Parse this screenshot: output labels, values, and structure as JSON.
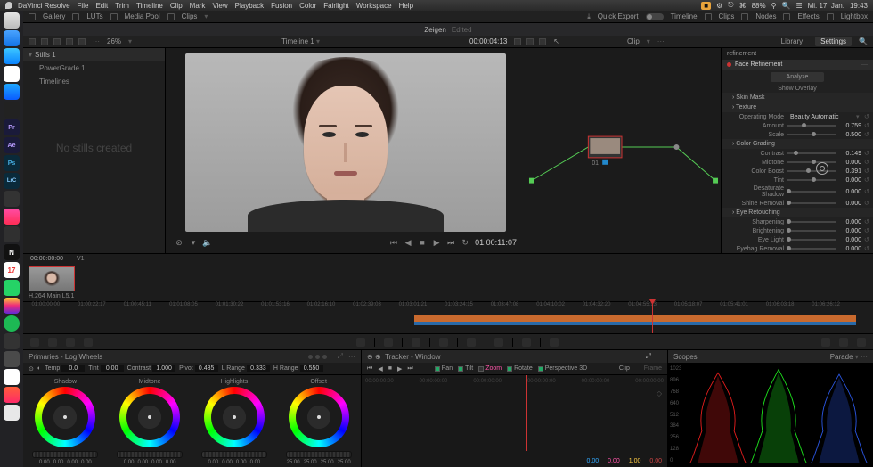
{
  "mac_menu": {
    "app": "DaVinci Resolve",
    "items": [
      "File",
      "Edit",
      "Trim",
      "Timeline",
      "Clip",
      "Mark",
      "View",
      "Playback",
      "Fusion",
      "Color",
      "Fairlight",
      "Workspace",
      "Help"
    ],
    "right": [
      "88%",
      "Mi. 17. Jan.",
      "19:43"
    ]
  },
  "topbar": {
    "items": [
      "Gallery",
      "LUTs",
      "Media Pool",
      "Clips"
    ],
    "right": [
      "Quick Export",
      "Timeline",
      "Clips",
      "Nodes",
      "Effects",
      "Lightbox"
    ]
  },
  "titlebar": {
    "name": "Zeigen",
    "status": "Edited"
  },
  "toolbar2": {
    "zoom": "26%",
    "timeline": "Timeline 1",
    "tc": "00:00:04:13",
    "clip": "Clip",
    "tabs": [
      "Library",
      "Settings"
    ],
    "active": "Settings"
  },
  "stills": {
    "hdr": "Stills 1",
    "rows": [
      "PowerGrade 1",
      "Timelines"
    ],
    "empty": "No stills created"
  },
  "viewer": {
    "tc": "01:00:11:07"
  },
  "nodes": {
    "id": "01"
  },
  "settings": {
    "search": "refinement",
    "section": "Face Refinement",
    "analyze": "Analyze",
    "overlay": "Show Overlay",
    "groups": [
      {
        "name": "Skin Mask"
      },
      {
        "name": "Texture",
        "params": [
          {
            "label": "Operating Mode",
            "mode": "Beauty Automatic"
          },
          {
            "label": "Amount",
            "val": "0.759",
            "pos": 30
          },
          {
            "label": "Scale",
            "val": "0.500",
            "pos": 50
          }
        ]
      },
      {
        "name": "Color Grading",
        "params": [
          {
            "label": "Contrast",
            "val": "0.149",
            "pos": 15
          },
          {
            "label": "Midtone",
            "val": "0.000",
            "pos": 50
          },
          {
            "label": "Color Boost",
            "val": "0.391",
            "pos": 40
          },
          {
            "label": "Tint",
            "val": "0.000",
            "pos": 50
          },
          {
            "label": "Desaturate Shadow",
            "val": "0.000",
            "pos": 0
          },
          {
            "label": "Shine Removal",
            "val": "0.000",
            "pos": 0
          }
        ]
      },
      {
        "name": "Eye Retouching",
        "params": [
          {
            "label": "Sharpening",
            "val": "0.000",
            "pos": 0
          },
          {
            "label": "Brightening",
            "val": "0.000",
            "pos": 0
          },
          {
            "label": "Eye Light",
            "val": "0.000",
            "pos": 0
          },
          {
            "label": "Eyebag Removal",
            "val": "0.000",
            "pos": 0
          }
        ]
      }
    ]
  },
  "thumb": {
    "tc": "00:00:00:00",
    "v": "V1",
    "name": "H.264 Main L5.1"
  },
  "timeline_ruler": [
    "01:00:00:00",
    "01:00:22:17",
    "01:00:45:11",
    "01:01:08:05",
    "01:01:30:22",
    "01:01:53:16",
    "01:02:16:10",
    "01:02:39:03",
    "01:03:01:21",
    "01:03:24:15",
    "01:03:47:08",
    "01:04:10:02",
    "01:04:32:20",
    "01:04:55:13",
    "01:05:18:07",
    "01:05:41:01",
    "01:06:03:18",
    "01:06:26:12"
  ],
  "wheels": {
    "title": "Primaries - Log Wheels",
    "globals": [
      {
        "l": "Temp",
        "v": "0.0"
      },
      {
        "l": "Tint",
        "v": "0.00"
      },
      {
        "l": "Contrast",
        "v": "1.000"
      },
      {
        "l": "Pivot",
        "v": "0.435"
      },
      {
        "l": "L Range",
        "v": "0.333"
      },
      {
        "l": "H Range",
        "v": "0.550"
      }
    ],
    "cells": [
      {
        "t": "Shadow",
        "n": [
          "0.00",
          "0.00",
          "0.00",
          "0.00"
        ]
      },
      {
        "t": "Midtone",
        "n": [
          "0.00",
          "0.00",
          "0.00",
          "0.00"
        ]
      },
      {
        "t": "Highlights",
        "n": [
          "0.00",
          "0.00",
          "0.00",
          "0.00"
        ]
      },
      {
        "t": "Offset",
        "n": [
          "25.00",
          "25.00",
          "25.00",
          "25.00"
        ]
      }
    ]
  },
  "tracker": {
    "title": "Tracker - Window",
    "opts": [
      "Pan",
      "Tilt",
      "Zoom",
      "Rotate",
      "Perspective 3D"
    ],
    "clip": "Clip",
    "frame": "Frame",
    "scale": [
      {
        "c": "#3af",
        "v": "0.00"
      },
      {
        "c": "#f5a",
        "v": "0.00"
      },
      {
        "c": "#fc4",
        "v": "1.00"
      },
      {
        "c": "#c44",
        "v": "0.00"
      }
    ]
  },
  "scopes": {
    "title": "Scopes",
    "mode": "Parade",
    "axis": [
      "1023",
      "896",
      "768",
      "640",
      "512",
      "384",
      "256",
      "128",
      "0"
    ]
  }
}
